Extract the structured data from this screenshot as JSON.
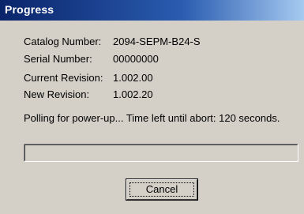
{
  "window": {
    "title": "Progress"
  },
  "info": {
    "catalog_number_label": "Catalog Number:",
    "catalog_number_value": "2094-SEPM-B24-S",
    "serial_number_label": "Serial Number:",
    "serial_number_value": "00000000",
    "current_revision_label": "Current Revision:",
    "current_revision_value": "1.002.00",
    "new_revision_label": "New Revision:",
    "new_revision_value": "1.002.20"
  },
  "status": {
    "message": "Polling for power-up... Time left until abort: 120 seconds."
  },
  "progress": {
    "fraction": 0
  },
  "buttons": {
    "cancel_label": "Cancel"
  },
  "colors": {
    "dialog_background": "#d4d0c8",
    "title_bar_start": "#0a246a",
    "title_bar_end": "#a6caf0",
    "title_text": "#ffffff"
  }
}
